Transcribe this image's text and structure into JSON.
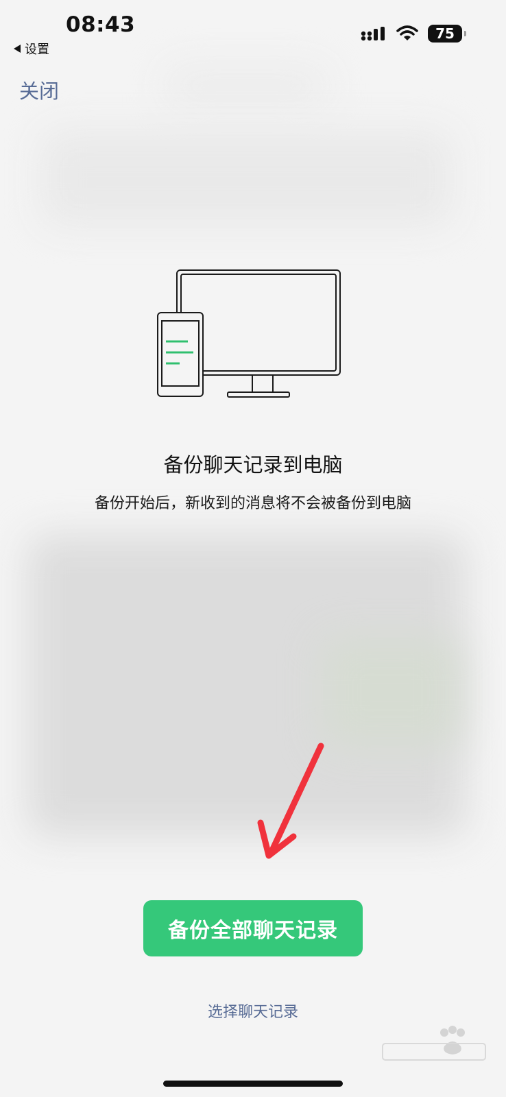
{
  "status_bar": {
    "time": "08:43",
    "back_label": "设置",
    "battery_level": "75",
    "signal_icon": "cellular-signal-icon",
    "wifi_icon": "wifi-icon"
  },
  "nav": {
    "close_label": "关闭"
  },
  "main": {
    "illustration_icon": "phone-to-computer-icon",
    "title": "备份聊天记录到电脑",
    "subtitle": "备份开始后，新收到的消息将不会被备份到电脑"
  },
  "actions": {
    "backup_all_label": "备份全部聊天记录",
    "select_label": "选择聊天记录"
  },
  "colors": {
    "accent_green": "#35c87a",
    "link_blue": "#576b95",
    "arrow_red": "#f0323c"
  }
}
